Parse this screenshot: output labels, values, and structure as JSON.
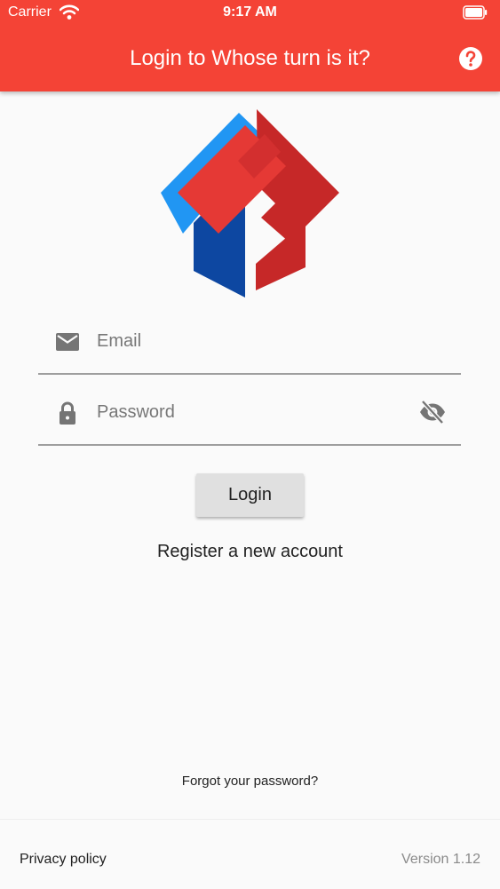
{
  "status_bar": {
    "carrier": "Carrier",
    "time": "9:17 AM"
  },
  "app_bar": {
    "title": "Login to Whose turn is it?",
    "help_icon": "help-circle-icon"
  },
  "logo": {
    "icon": "app-logo",
    "colors": {
      "blue_light": "#2196f3",
      "blue_dark": "#0d47a1",
      "red": "#e53935",
      "red_dark": "#c62828"
    }
  },
  "form": {
    "email": {
      "placeholder": "Email",
      "value": "",
      "icon": "mail-icon"
    },
    "password": {
      "placeholder": "Password",
      "value": "",
      "icon": "lock-icon",
      "toggle_icon": "eye-off-icon"
    },
    "login_label": "Login",
    "register_label": "Register a new account",
    "forgot_label": "Forgot your password?"
  },
  "footer": {
    "privacy_label": "Privacy policy",
    "version": "Version 1.12"
  },
  "colors": {
    "accent": "#f44336",
    "background": "#fafafa",
    "button": "#e0e0e0"
  }
}
